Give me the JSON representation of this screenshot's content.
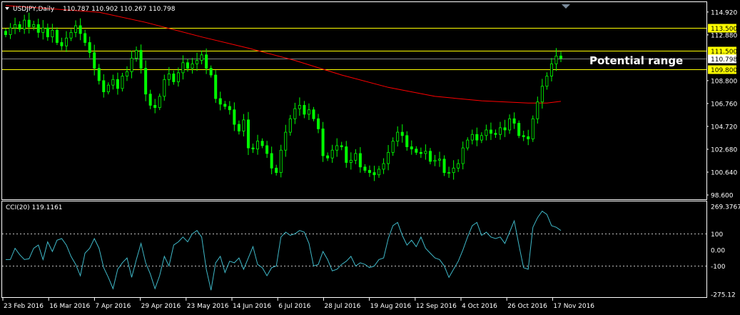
{
  "header": {
    "symbol": "USDJPY,Daily",
    "ohlc": "110.787 110.902 110.267 110.798"
  },
  "annotation": "Potential range",
  "colors": {
    "background": "#000000",
    "frame": "#ffffff",
    "candle": "#00ff00",
    "ma": "#ff0000",
    "level_line": "#ffff00",
    "level_label_bg": "#ffff00",
    "cci_line": "#3fb8c8"
  },
  "chart_data": [
    {
      "type": "candlestick",
      "symbol": "USDJPY",
      "timeframe": "Daily",
      "ylim": [
        98.6,
        115.1
      ],
      "y_ticks": [
        "114.920",
        "112.880",
        "110.798",
        "108.800",
        "106.760",
        "104.720",
        "102.680",
        "100.640",
        "98.600"
      ],
      "x_ticks": [
        "23 Feb 2016",
        "16 Mar 2016",
        "7 Apr 2016",
        "29 Apr 2016",
        "23 May 2016",
        "14 Jun 2016",
        "6 Jul 2016",
        "28 Jul 2016",
        "19 Aug 2016",
        "12 Sep 2016",
        "4 Oct 2016",
        "26 Oct 2016",
        "17 Nov 2016"
      ],
      "current_price": "110.798",
      "horizontal_levels": [
        "113.500",
        "111.500",
        "109.800"
      ],
      "closes": [
        112.9,
        113.5,
        113.8,
        113.4,
        114.2,
        113.6,
        113.8,
        113.1,
        113.5,
        112.7,
        113.3,
        112.2,
        111.9,
        112.6,
        113.1,
        113.7,
        113.0,
        112.2,
        111.3,
        109.9,
        108.8,
        107.8,
        108.4,
        108.9,
        108.1,
        109.2,
        109.6,
        110.8,
        111.5,
        109.9,
        107.6,
        106.6,
        106.4,
        107.4,
        108.9,
        109.4,
        108.7,
        109.5,
        110.4,
        109.9,
        110.3,
        110.6,
        111.1,
        109.9,
        109.3,
        107.2,
        106.7,
        106.5,
        106.2,
        104.9,
        104.3,
        105.3,
        102.8,
        102.7,
        103.4,
        103.0,
        102.3,
        101.0,
        100.6,
        102.6,
        104.2,
        105.4,
        106.3,
        106.6,
        105.8,
        106.2,
        105.4,
        104.5,
        102.1,
        101.9,
        102.6,
        103.0,
        102.9,
        101.5,
        101.7,
        102.3,
        101.1,
        100.8,
        100.6,
        100.4,
        100.9,
        101.4,
        102.4,
        103.4,
        104.2,
        103.9,
        102.9,
        102.7,
        102.4,
        102.3,
        102.5,
        101.6,
        101.7,
        101.8,
        100.6,
        100.6,
        101.0,
        101.4,
        102.8,
        103.5,
        104.0,
        103.5,
        103.9,
        104.4,
        104.1,
        104.0,
        104.6,
        104.4,
        105.4,
        105.0,
        103.9,
        103.8,
        103.6,
        105.4,
        106.9,
        108.3,
        109.2,
        110.3,
        111.0,
        110.8
      ],
      "moving_average": {
        "points": [
          [
            0,
            115.5
          ],
          [
            20,
            114.9
          ],
          [
            30,
            114.0
          ],
          [
            42,
            112.7
          ],
          [
            52,
            111.7
          ],
          [
            62,
            110.6
          ],
          [
            72,
            109.3
          ],
          [
            82,
            108.2
          ],
          [
            92,
            107.4
          ],
          [
            102,
            107.0
          ],
          [
            112,
            106.8
          ],
          [
            116,
            106.8
          ],
          [
            119,
            106.95
          ]
        ]
      }
    },
    {
      "type": "line",
      "indicator": "CCI(20)",
      "value_label": "119.1161",
      "ylim": [
        -275.12,
        269.3767
      ],
      "y_ticks": [
        "269.3767",
        "100",
        "0.00",
        "-100",
        "-275.12"
      ],
      "reference_levels": [
        100,
        -100
      ],
      "values": [
        -60,
        -60,
        10,
        -30,
        -60,
        -55,
        10,
        30,
        -60,
        50,
        -10,
        60,
        70,
        30,
        -40,
        -90,
        -160,
        -20,
        10,
        70,
        10,
        -110,
        -170,
        -240,
        -120,
        -80,
        -50,
        -170,
        -60,
        40,
        -80,
        -150,
        -240,
        -160,
        -40,
        -100,
        30,
        50,
        80,
        50,
        100,
        120,
        80,
        -120,
        -250,
        -80,
        -40,
        -140,
        -70,
        -80,
        -50,
        -120,
        -50,
        20,
        -90,
        -110,
        -160,
        -110,
        -100,
        80,
        110,
        90,
        100,
        120,
        110,
        40,
        -100,
        -90,
        -10,
        -60,
        -130,
        -120,
        -90,
        -70,
        -40,
        -100,
        -80,
        -90,
        -110,
        -100,
        -60,
        -50,
        70,
        150,
        170,
        90,
        30,
        60,
        20,
        80,
        10,
        -20,
        -50,
        -60,
        -100,
        -170,
        -120,
        -70,
        0,
        80,
        150,
        170,
        90,
        110,
        80,
        70,
        80,
        40,
        110,
        180,
        30,
        -110,
        -120,
        140,
        200,
        240,
        220,
        150,
        140,
        120
      ]
    }
  ]
}
